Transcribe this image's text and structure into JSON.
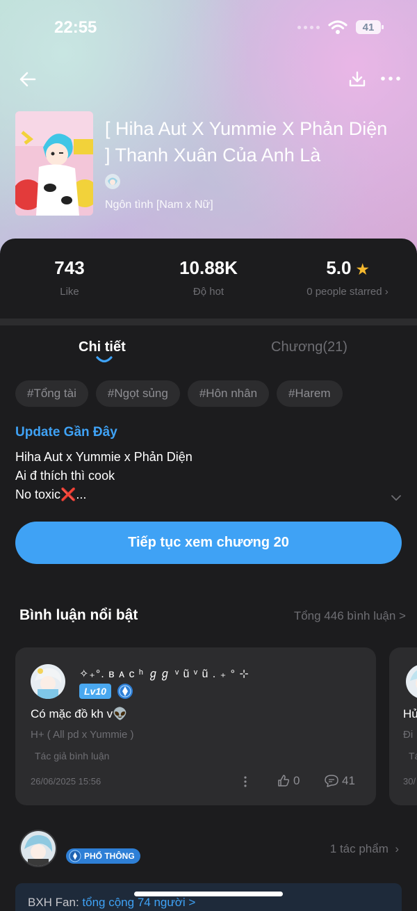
{
  "status_bar": {
    "time": "22:55",
    "battery": "41"
  },
  "colors": {
    "accent": "#3fa2f5",
    "background": "#1c1c1e",
    "card": "#2c2c2e",
    "star": "#f5b82e"
  },
  "header": {
    "title": "[ Hiha Aut X Yummie X Phản Diện ] Thanh Xuân Của Anh Là",
    "genre": "Ngôn tình [Nam x Nữ]",
    "icons": [
      "back-arrow-icon",
      "download-icon",
      "more-icon"
    ]
  },
  "stats": [
    {
      "value": "743",
      "label": "Like"
    },
    {
      "value": "10.88K",
      "label": "Độ hot"
    },
    {
      "value": "5.0",
      "label": "0 people starred"
    }
  ],
  "tabs": [
    {
      "label": "Chi tiết",
      "active": true
    },
    {
      "label": "Chương(21)",
      "active": false
    }
  ],
  "tags": [
    "#Tổng tài",
    "#Ngọt sủng",
    "#Hôn nhân",
    "#Harem"
  ],
  "update": {
    "heading": "Update Gần Đây",
    "line1": "Hiha Aut x Yummie x Phản Diện",
    "line2": "Ai đ thích thì cook",
    "line3": "No toxic❌..."
  },
  "continue_button": "Tiếp tục xem chương 20",
  "comments": {
    "heading": "Bình luận nổi bật",
    "total": "Tổng 446 bình luận >",
    "items": [
      {
        "name": "✧₊°. ʙ ᴀ ᴄ ʰ ℊℊ ᵛ ũ  ᵛ ũ . ₊ ° ⊹",
        "level": "Lv10",
        "text": "Có mặc đồ kh v👽",
        "chapter": "H+ ( All pd x Yummie )",
        "author_tag": "Tác giả bình luận",
        "date": "26/06/2025 15:56",
        "likes": "0",
        "replies": "41"
      }
    ],
    "peek": {
      "line1": "Hủ",
      "line2": "Đi",
      "line3": "Tá",
      "line4": "30/"
    }
  },
  "author": {
    "rank": "PHỔ THÔNG",
    "works": "1 tác phẩm"
  },
  "fan_ranking": {
    "label": "BXH Fan: ",
    "link": "tổng cộng 74 người >"
  }
}
